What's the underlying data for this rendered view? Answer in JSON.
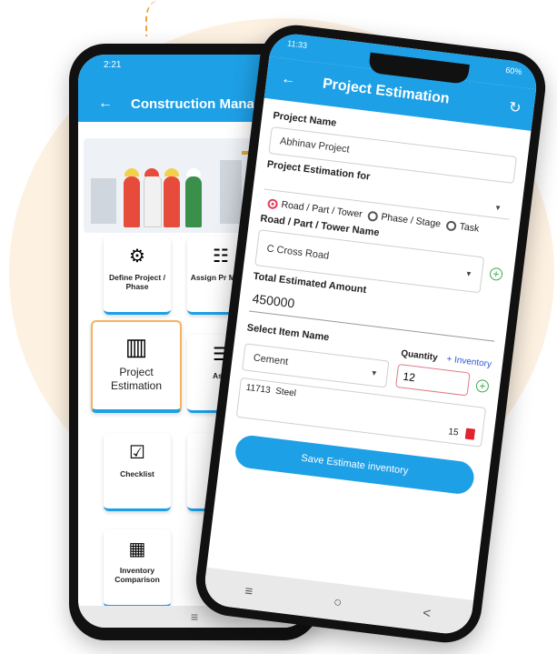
{
  "colors": {
    "primary": "#1ea0e6",
    "accent": "#f4a63a",
    "danger": "#e2232f",
    "success": "#3ba94b",
    "link": "#2f5cd8"
  },
  "back_screen": {
    "status_time": "2:21",
    "appbar_title": "Construction Manag",
    "tiles": [
      {
        "label": "Define Project / Phase",
        "icon": "gear-bulb-icon"
      },
      {
        "label": "Assign Pr Memb",
        "icon": "team-desk-icon"
      },
      {
        "label": "Project Estimation",
        "icon": "chart-estimate-icon",
        "selected": true
      },
      {
        "label": "Assi",
        "icon": "assign-list-icon"
      },
      {
        "label": "Checklist",
        "icon": "checklist-icon"
      },
      {
        "label": "S",
        "icon": "doc-icon"
      },
      {
        "label": "Inventory Comparison",
        "icon": "comparison-chart-icon"
      }
    ],
    "nav_menu_glyph": "≡"
  },
  "front_screen": {
    "status_time": "11:33",
    "status_right": "60%",
    "appbar_title": "Project Estimation",
    "project_name_label": "Project Name",
    "project_name_value": "Abhinav Project",
    "estimation_for_label": "Project Estimation for",
    "estimation_options": [
      {
        "label": "Road / Part / Tower",
        "selected": true
      },
      {
        "label": "Phase / Stage",
        "selected": false
      },
      {
        "label": "Task",
        "selected": false
      }
    ],
    "road_label": "Road / Part / Tower Name",
    "road_value": "C Cross Road",
    "total_label": "Total Estimated Amount",
    "total_value": "450000",
    "select_item_label": "Select Item Name",
    "quantity_label": "Quantity",
    "inventory_link": "+ Inventory",
    "item_value": "Cement",
    "quantity_value": "12",
    "list_item_code": "11713",
    "list_item_name": "Steel",
    "list_item_qty": "15",
    "save_button": "Save Estimate inventory"
  }
}
